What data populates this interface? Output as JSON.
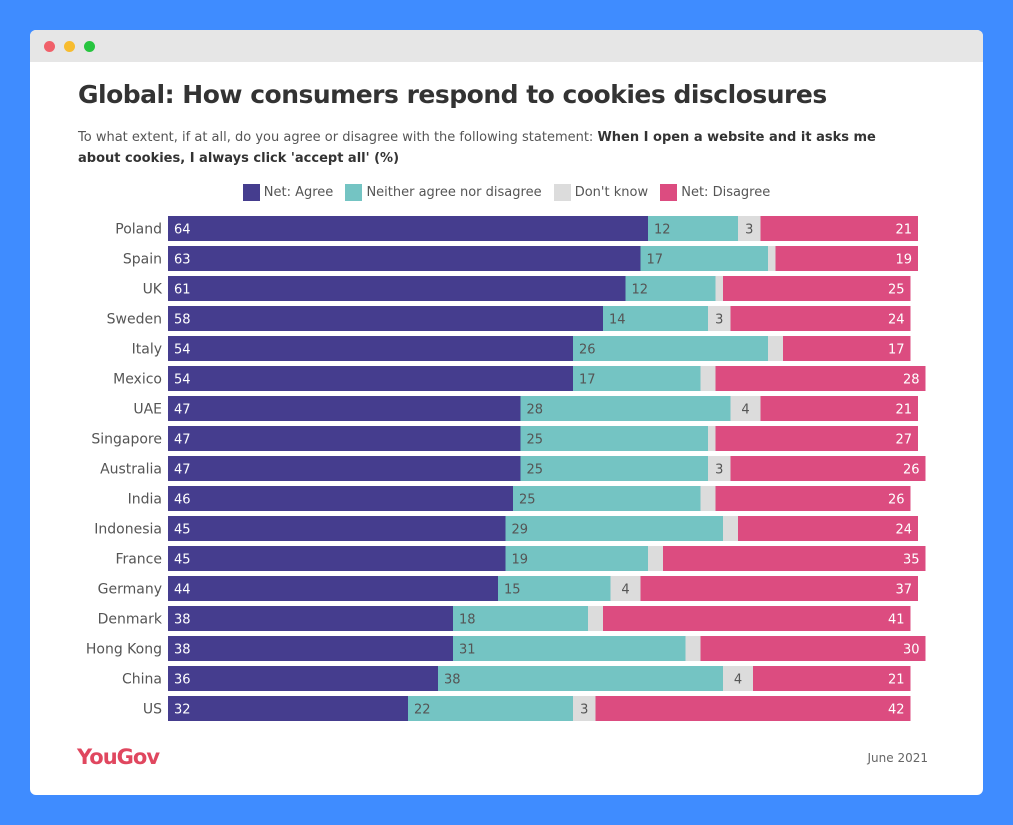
{
  "window": {
    "controls": [
      "close",
      "minimize",
      "maximize"
    ]
  },
  "chart_data": {
    "type": "bar",
    "orientation": "horizontal",
    "stacked": true,
    "title": "Global: How consumers respond to cookies disclosures",
    "subtitle_plain": "To what extent, if at all, do you agree or disagree with the following statement: ",
    "subtitle_bold": "When I open a website and it asks me about cookies, I always click 'accept all' (%)",
    "xlabel": "",
    "ylabel": "",
    "xlim": [
      0,
      100
    ],
    "grid": false,
    "legend_position": "top-center",
    "categories": [
      "Poland",
      "Spain",
      "UK",
      "Sweden",
      "Italy",
      "Mexico",
      "UAE",
      "Singapore",
      "Australia",
      "India",
      "Indonesia",
      "France",
      "Germany",
      "Denmark",
      "Hong Kong",
      "China",
      "US"
    ],
    "series": [
      {
        "name": "Net: Agree",
        "color": "#453d8e",
        "label_color": "#ffffff",
        "values": [
          64,
          63,
          61,
          58,
          54,
          54,
          47,
          47,
          47,
          46,
          45,
          45,
          44,
          38,
          38,
          36,
          32
        ],
        "labels": [
          "64",
          "63",
          "61",
          "58",
          "54",
          "54",
          "47",
          "47",
          "47",
          "46",
          "45",
          "45",
          "44",
          "38",
          "38",
          "36",
          "32"
        ]
      },
      {
        "name": "Neither agree nor disagree",
        "color": "#74c4c3",
        "label_color": "#555555",
        "values": [
          12,
          17,
          12,
          14,
          26,
          17,
          28,
          25,
          25,
          25,
          29,
          19,
          15,
          18,
          31,
          38,
          22
        ],
        "labels": [
          "12",
          "17",
          "12",
          "14",
          "26",
          "17",
          "28",
          "25",
          "25",
          "25",
          "29",
          "19",
          "15",
          "18",
          "31",
          "38",
          "22"
        ]
      },
      {
        "name": "Don't know",
        "color": "#dcdcdc",
        "label_color": "#555555",
        "values": [
          3,
          1,
          1,
          3,
          2,
          2,
          4,
          1,
          3,
          2,
          2,
          2,
          4,
          2,
          2,
          4,
          3
        ],
        "labels": [
          "3",
          "",
          "",
          "3",
          "",
          "",
          "4",
          "",
          "3",
          "",
          "",
          "",
          "4",
          "",
          "",
          "4",
          "3"
        ]
      },
      {
        "name": "Net: Disagree",
        "color": "#dc4c80",
        "label_color": "#ffffff",
        "values": [
          21,
          19,
          25,
          24,
          17,
          28,
          21,
          27,
          26,
          26,
          24,
          35,
          37,
          41,
          30,
          21,
          42
        ],
        "labels": [
          "21",
          "19",
          "25",
          "24",
          "17",
          "28",
          "21",
          "27",
          "26",
          "26",
          "24",
          "35",
          "37",
          "41",
          "30",
          "21",
          "42"
        ]
      }
    ]
  },
  "footer": {
    "logo": "YouGov",
    "date": "June 2021"
  }
}
